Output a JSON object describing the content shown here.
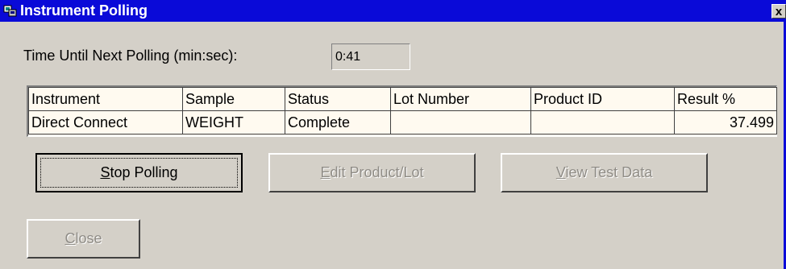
{
  "window": {
    "title": "Instrument Polling",
    "close_glyph": "x"
  },
  "polling": {
    "label": "Time Until Next Polling (min:sec):",
    "time_value": "0:41"
  },
  "grid": {
    "columns": [
      "Instrument",
      "Sample",
      "Status",
      "Lot Number",
      "Product ID",
      "Result %"
    ],
    "rows": [
      [
        "Direct Connect",
        "WEIGHT",
        "Complete",
        "",
        "",
        "37.499"
      ]
    ]
  },
  "buttons": {
    "stop_polling": {
      "accel": "S",
      "rest": "top Polling"
    },
    "edit_product_lot": {
      "accel": "E",
      "rest": "dit Product/Lot"
    },
    "view_test_data": {
      "accel": "V",
      "rest": "iew Test Data"
    },
    "close": {
      "accel": "C",
      "rest": "lose"
    }
  },
  "icons": {
    "app_icon": "instrument-app-icon"
  },
  "colors": {
    "titlebar": "#0a0ad8",
    "face": "#d4d0c8",
    "grid_bg": "#fffaf0",
    "disabled_text": "#8f8c86"
  }
}
